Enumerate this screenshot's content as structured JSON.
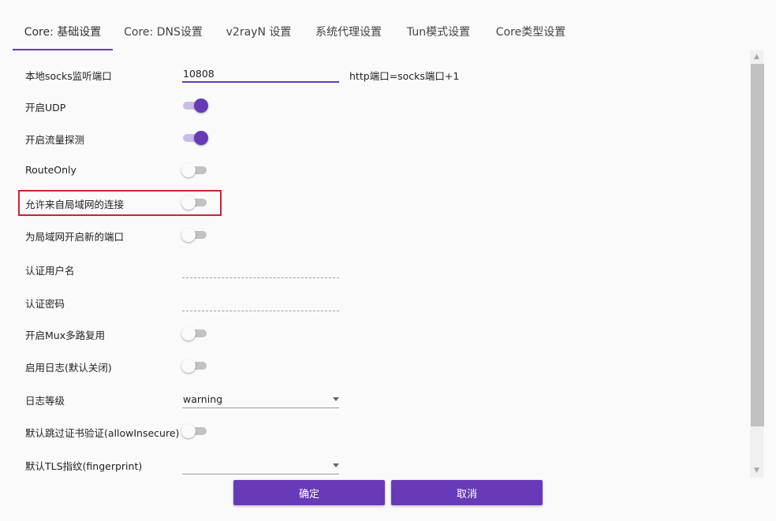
{
  "tabs": [
    {
      "label": "Core: 基础设置"
    },
    {
      "label": "Core: DNS设置"
    },
    {
      "label": "v2rayN 设置"
    },
    {
      "label": "系统代理设置"
    },
    {
      "label": "Tun模式设置"
    },
    {
      "label": "Core类型设置"
    }
  ],
  "form": {
    "socks_port": {
      "label": "本地socks监听端口",
      "value": "10808",
      "hint": "http端口=socks端口+1"
    },
    "udp": {
      "label": "开启UDP",
      "on": true
    },
    "sniffing": {
      "label": "开启流量探测",
      "on": true
    },
    "route_only": {
      "label": "RouteOnly",
      "on": false
    },
    "allow_lan": {
      "label": "允许来自局域网的连接",
      "on": false
    },
    "new_lan_port": {
      "label": "为局域网开启新的端口",
      "on": false
    },
    "auth_user": {
      "label": "认证用户名",
      "value": ""
    },
    "auth_pass": {
      "label": "认证密码",
      "value": ""
    },
    "mux": {
      "label": "开启Mux多路复用",
      "on": false
    },
    "log_enabled": {
      "label": "启用日志(默认关闭)",
      "on": false
    },
    "log_level": {
      "label": "日志等级",
      "value": "warning"
    },
    "allow_insecure": {
      "label": "默认跳过证书验证(allowInsecure)",
      "on": false
    },
    "fingerprint": {
      "label": "默认TLS指纹(fingerprint)",
      "value": ""
    }
  },
  "buttons": {
    "ok": "确定",
    "cancel": "取消"
  },
  "colors": {
    "accent": "#673ab7",
    "highlight": "#d32029"
  }
}
